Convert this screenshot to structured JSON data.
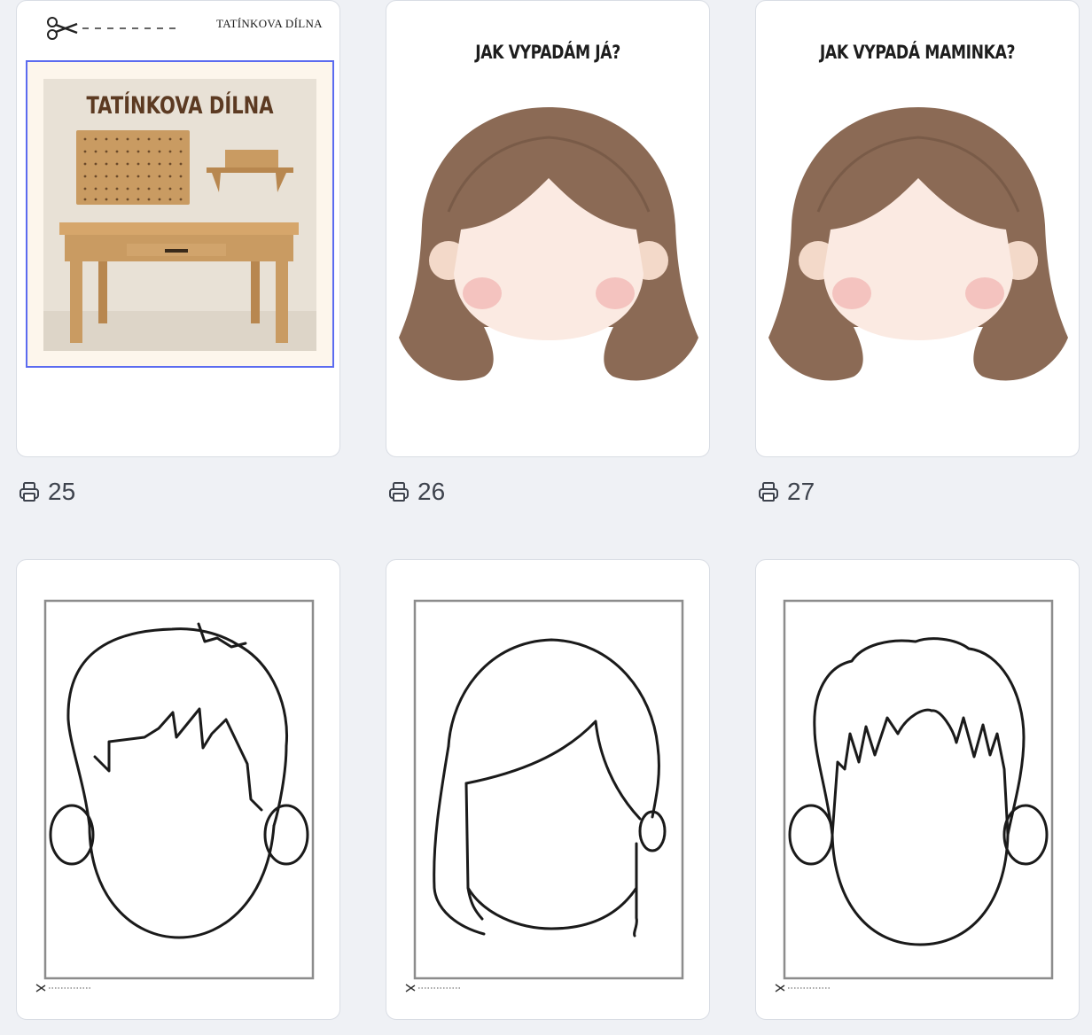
{
  "pages_top": [
    {
      "number": "25",
      "brand": "TATÍNKOVA DÍLNA",
      "image_title": "TATÍNKOVA DÍLNA"
    },
    {
      "number": "26",
      "title": "JAK VYPADÁM JÁ?"
    },
    {
      "number": "27",
      "title": "JAK VYPADÁ MAMINKA?"
    }
  ],
  "pages_bottom": [
    {
      "subject": "boy face outline"
    },
    {
      "subject": "girl face outline"
    },
    {
      "subject": "man face outline"
    }
  ],
  "colors": {
    "background": "#eff1f5",
    "card": "#ffffff",
    "selection": "#5b6bf0",
    "hair": "#8b6a55",
    "text": "#3e434d"
  },
  "icons": {
    "page_print": "printer-icon",
    "cut": "scissors-icon"
  }
}
